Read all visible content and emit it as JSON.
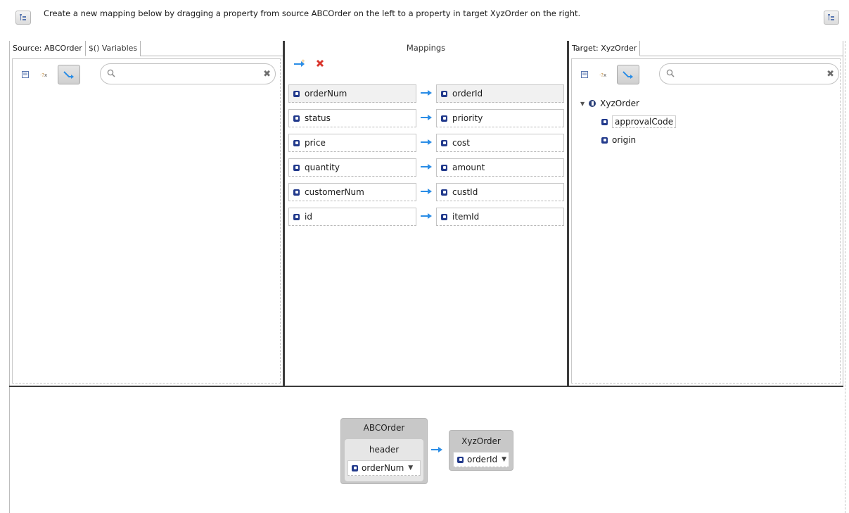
{
  "header": {
    "message": "Create a new mapping below by dragging a property from source ABCOrder on the left to a property in target XyzOrder  on the right.",
    "left_button_icon": "layout-toggle-icon",
    "right_button_icon": "layout-toggle-icon"
  },
  "source": {
    "tab_label": "Source: ABCOrder",
    "variables_tab_label": "$() Variables",
    "search_placeholder": ""
  },
  "mappings": {
    "title": "Mappings",
    "rows": [
      {
        "source": "orderNum",
        "target": "orderId"
      },
      {
        "source": "status",
        "target": "priority"
      },
      {
        "source": "price",
        "target": "cost"
      },
      {
        "source": "quantity",
        "target": "amount"
      },
      {
        "source": "customerNum",
        "target": "custId"
      },
      {
        "source": "id",
        "target": "itemId"
      }
    ]
  },
  "target": {
    "tab_label": "Target: XyzOrder",
    "search_placeholder": "",
    "tree": {
      "root": "XyzOrder",
      "children": [
        "approvalCode",
        "origin"
      ]
    }
  },
  "detail": {
    "source_node": "ABCOrder",
    "source_subnode": "header",
    "source_field": "orderNum",
    "target_node": "XyzOrder",
    "target_field": "orderId"
  },
  "colors": {
    "accent_blue": "#2b8de6",
    "delete_red": "#d9342b",
    "property_icon": "#223a8c"
  }
}
